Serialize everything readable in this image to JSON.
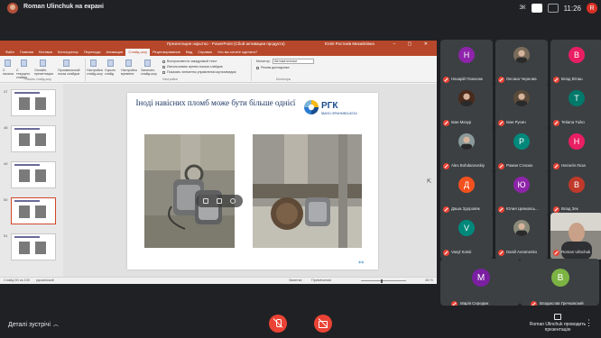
{
  "topbar": {
    "presenter_title": "Roman Ulinchuk на екрані",
    "time": "11:26",
    "me_initial": "R",
    "layout_badge": "ЗК"
  },
  "powerpoint": {
    "window_title": "Презентация окрытно - PowerPoint (Сбой активации продукта)",
    "user": "Юлія Ростиків Михайлівна",
    "tabs": [
      "Файл",
      "Главная",
      "Вставка",
      "Конструктор",
      "Переходы",
      "Анимация",
      "Слайд-шоу",
      "Рецензирование",
      "Вид",
      "Справка",
      "Что вы хотите сделать?"
    ],
    "active_tab": "Слайд-шоу",
    "ribbon": {
      "btn_from_start": "С начала",
      "btn_current": "С текущего слайда",
      "btn_online": "Онлайн-презентация",
      "btn_custom": "Произвольный показ слайдов",
      "group_start": "Начать слайд-шоу",
      "btn_setup": "Настройка слайд-шоу",
      "btn_hide": "Скрыть слайд",
      "btn_rehearse": "Настройка времени",
      "btn_record": "Записать слайд-шоу",
      "check_narration": "Воспроизвести закадровый текст",
      "check_timings": "Использовать время показа слайдов",
      "check_controls": "Показать элементы управления мультимедиа",
      "group_setup": "Настройка",
      "monitor_label": "Монитор:",
      "monitor_value": "Автоматически",
      "presenter_view": "Режим докладчика",
      "group_monitors": "Мониторы"
    },
    "thumb_numbers": [
      "47",
      "48",
      "49",
      "50",
      "51"
    ],
    "slide": {
      "title": "Іноді навісних пломб може бути більше однієї",
      "logo_text": "РГК",
      "logo_sub": "ІВАНО-ФРАНКІВСЬКГАЗ"
    },
    "status": {
      "slide_count": "Слайд 50 из 100",
      "lang": "украинский",
      "notes": "Заметки",
      "comments": "Примечания",
      "zoom": "66 %"
    }
  },
  "participants": [
    {
      "name": "Назарій Панасюк",
      "initial": "Н",
      "color": "#8e24aa"
    },
    {
      "name": "Оксана Чернова",
      "initial": "",
      "color": "#7a6b5a",
      "photo": true
    },
    {
      "name": "Влад Віташ",
      "initial": "В",
      "color": "#e91e63"
    },
    {
      "name": "Іван Мазур",
      "initial": "",
      "color": "#4a2a1a",
      "photo": true
    },
    {
      "name": "Іван Русин",
      "initial": "",
      "color": "#5a4a3a",
      "photo": true
    },
    {
      "name": "Tetiana Tuiko",
      "initial": "T",
      "color": "#00796b"
    },
    {
      "name": "Alex Bohdanovskiy",
      "initial": "",
      "color": "#8a9a9a",
      "photo": true
    },
    {
      "name": "Роман Стасюк",
      "initial": "Р",
      "color": "#00897b"
    },
    {
      "name": "Наталія Лоза",
      "initial": "Н",
      "color": "#e91e63"
    },
    {
      "name": "Даша Здоровяк",
      "initial": "Д",
      "color": "#f4511e"
    },
    {
      "name": "Юлия Цевковсь...",
      "initial": "Ю",
      "color": "#8e24aa"
    },
    {
      "name": "Влад Зек",
      "initial": "В",
      "color": "#c0392b"
    },
    {
      "name": "Vasyl Kotsii",
      "initial": "V",
      "color": "#00897b"
    },
    {
      "name": "Daniil Avramenko",
      "initial": "",
      "color": "#8a8a7a",
      "photo": true
    },
    {
      "name": "Roman Ulinchuk",
      "initial": "",
      "color": "#c8b0a0",
      "camera": true
    },
    {
      "name": "Марія Середюк",
      "initial": "М",
      "color": "#7b1fa2"
    },
    {
      "name": "Владислав Гречковский",
      "initial": "В",
      "color": "#7cb342"
    }
  ],
  "bottombar": {
    "details": "Деталі зустрічі",
    "present_text": "Roman Ulinchuk проводить презентацію"
  },
  "colors": {
    "ppt_accent": "#b7472a",
    "meet_red": "#ea4335",
    "background": "#202124"
  }
}
